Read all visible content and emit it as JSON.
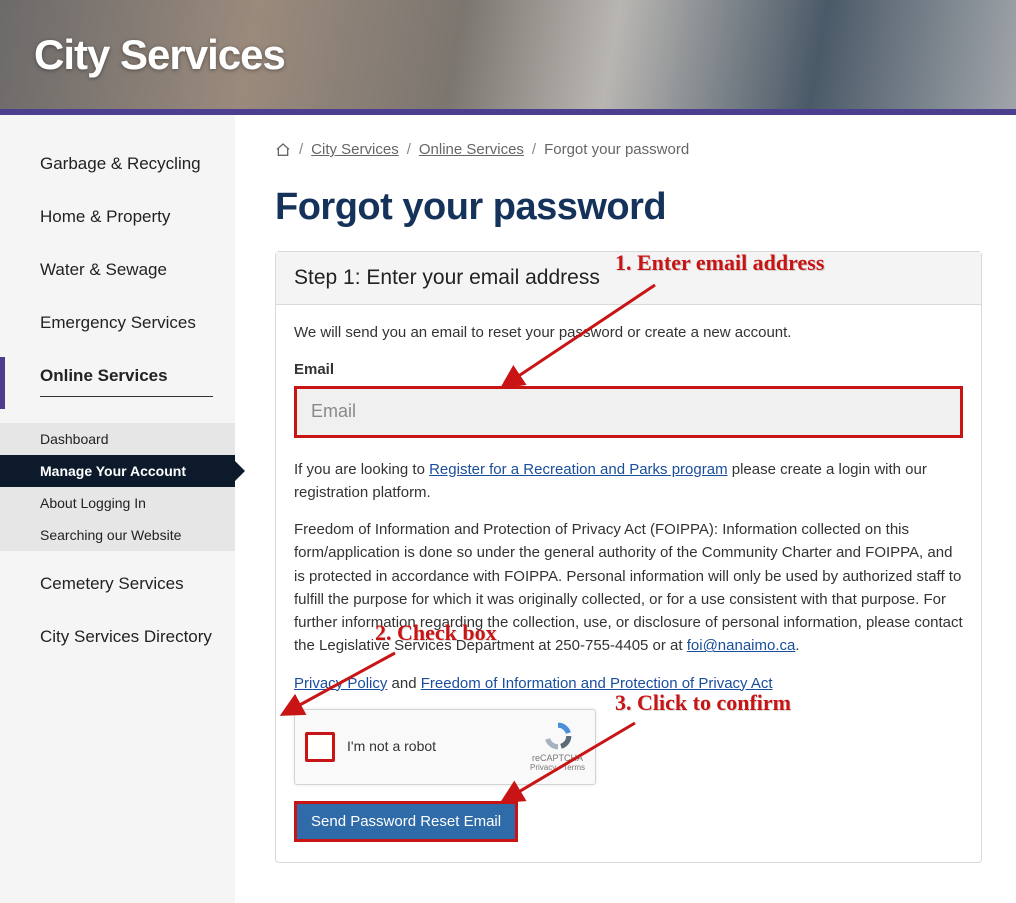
{
  "banner": {
    "title": "City Services"
  },
  "breadcrumb": {
    "items": [
      "City Services",
      "Online Services",
      "Forgot your password"
    ]
  },
  "page": {
    "title": "Forgot your password"
  },
  "sidebar": {
    "items": [
      {
        "label": "Garbage & Recycling"
      },
      {
        "label": "Home & Property"
      },
      {
        "label": "Water & Sewage"
      },
      {
        "label": "Emergency Services"
      },
      {
        "label": "Online Services",
        "active": true,
        "children": [
          {
            "label": "Dashboard"
          },
          {
            "label": "Manage Your Account",
            "selected": true
          },
          {
            "label": "About Logging In"
          },
          {
            "label": "Searching our Website"
          }
        ]
      },
      {
        "label": "Cemetery Services"
      },
      {
        "label": "City Services Directory"
      }
    ]
  },
  "panel": {
    "step_title": "Step 1: Enter your email address",
    "intro": "We will send you an email to reset your password or create a new account.",
    "email_label": "Email",
    "email_placeholder": "Email",
    "register_prefix": "If you are looking to ",
    "register_link": "Register for a Recreation and Parks program",
    "register_suffix": " please create a login with our registration platform.",
    "foippa": "Freedom of Information and Protection of Privacy Act (FOIPPA): Information collected on this form/application is done so under the general authority of the Community Charter and FOIPPA, and is protected in accordance with FOIPPA. Personal information will only be used by authorized staff to fulfill the purpose for which it was originally collected, or for a use consistent with that purpose. For further information regarding the collection, use, or disclosure of personal information, please contact the Legislative Services Department at 250-755-4405 or at ",
    "foi_email": "foi@nanaimo.ca",
    "foi_period": ".",
    "privacy_link": "Privacy Policy",
    "privacy_and": " and ",
    "foippa_link": "Freedom of Information and Protection of Privacy Act",
    "recaptcha_label": "I'm not a robot",
    "recaptcha_brand": "reCAPTCHA",
    "recaptcha_links": "Privacy - Terms",
    "submit_label": "Send Password Reset Email"
  },
  "annotations": {
    "a1": "1. Enter email address",
    "a2": "2. Check box",
    "a3": "3. Click to confirm"
  }
}
